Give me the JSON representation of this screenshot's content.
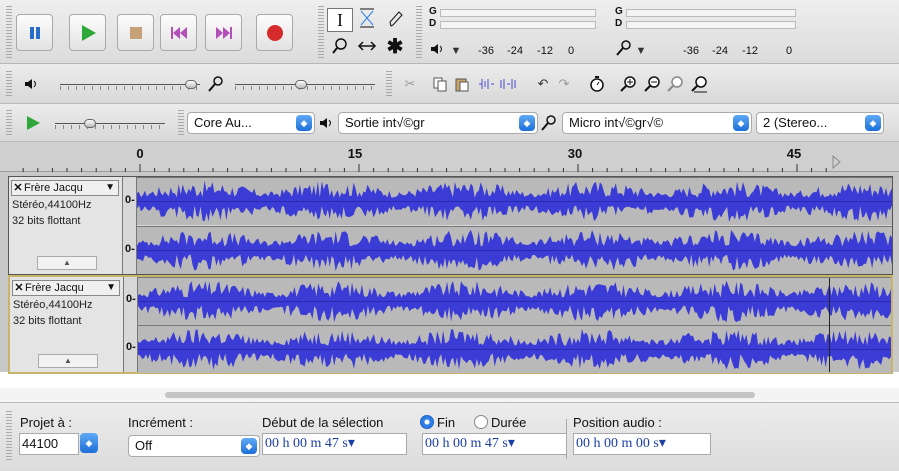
{
  "transport": {
    "pause": "pause-icon",
    "play": "play-icon",
    "stop": "stop-icon",
    "skip_start": "skip-to-start-icon",
    "skip_end": "skip-to-end-icon",
    "record": "record-icon"
  },
  "tools": {
    "selection": "I",
    "multi": "✱"
  },
  "meters": {
    "play_channels": [
      "G",
      "D"
    ],
    "rec_channels": [
      "G",
      "D"
    ],
    "scale": [
      "-36",
      "-24",
      "-12",
      "0"
    ]
  },
  "device": {
    "host": "Core Au...",
    "output": "Sortie int√©gr",
    "input": "Micro int√©gr√©",
    "channels": "2 (Stereo..."
  },
  "ruler": {
    "labels": [
      "0",
      "15",
      "30",
      "45"
    ]
  },
  "tracks": [
    {
      "name": "Frère Jacqu",
      "info1": "Stéréo,44100Hz",
      "info2": "32 bits flottant",
      "zero": "0-",
      "selected": false
    },
    {
      "name": "Frère Jacqu",
      "info1": "Stéréo,44100Hz",
      "info2": "32 bits flottant",
      "zero": "0-",
      "selected": true
    }
  ],
  "selection_bar": {
    "project_rate_label": "Projet à :",
    "project_rate": "44100",
    "snap_label": "Incrément :",
    "snap_value": "Off",
    "start_label": "Début de la sélection",
    "end_label": "Fin",
    "length_label": "Durée",
    "audio_pos_label": "Position audio :",
    "start_time": "00 h 00 m 47 s",
    "end_time": "00 h 00 m 47 s",
    "audio_pos": "00 h 00 m 00 s"
  },
  "colors": {
    "waveform": "#3b3bd6",
    "record": "#d62b2b",
    "play": "#2fa83a",
    "accent": "#2f7ee6",
    "selected_border": "#c8b46a"
  }
}
